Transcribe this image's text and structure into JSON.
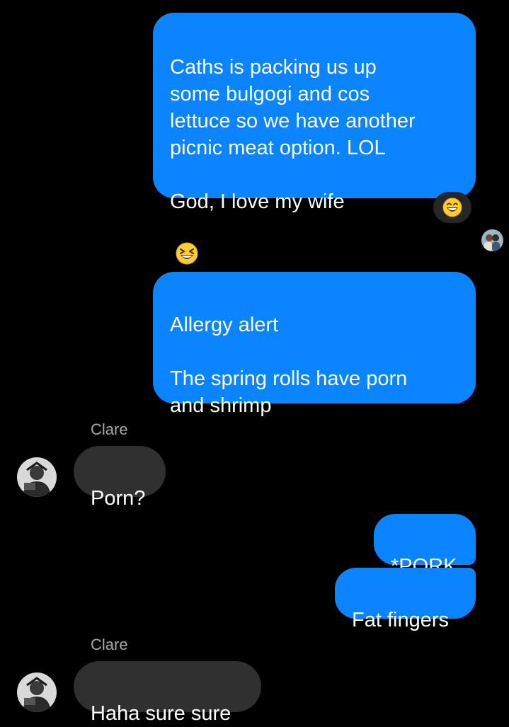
{
  "conversation": {
    "messages": [
      {
        "direction": "outgoing",
        "text": "Caths is packing us up\nsome bulgogi and cos\nlettuce so we have another\npicnic meat option. LOL\n\nGod, I love my wife"
      },
      {
        "direction": "outgoing",
        "text": "Allergy alert\n\nThe spring rolls have porn\nand shrimp"
      },
      {
        "direction": "incoming",
        "sender": "Clare",
        "text": "Porn?"
      },
      {
        "direction": "outgoing",
        "text": "*PORK"
      },
      {
        "direction": "outgoing",
        "text": "Fat fingers"
      },
      {
        "direction": "incoming",
        "sender": "Clare",
        "text": "Haha sure sure"
      }
    ],
    "reaction_icon": "laughing-face-emoji",
    "inline_emoji_icon": "grinning-squinting-face-emoji",
    "seen_avatar_icon": "read-receipt-avatar"
  },
  "colors": {
    "background": "#000000",
    "outgoing_bubble": "#0A84FF",
    "incoming_bubble": "#303030",
    "sender_name": "#a8a8a8"
  }
}
